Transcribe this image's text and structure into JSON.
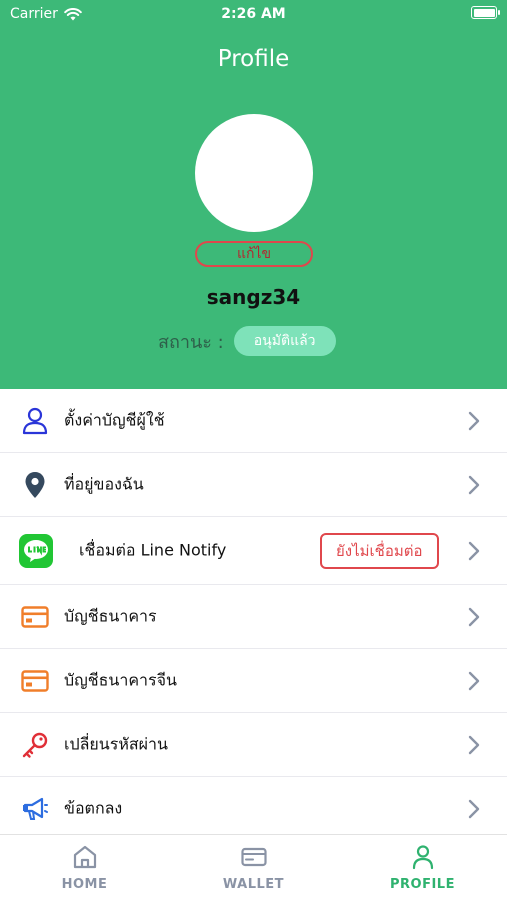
{
  "status_bar": {
    "carrier": "Carrier",
    "time": "2:26 AM"
  },
  "header": {
    "title": "Profile",
    "edit_label": "แก้ไข",
    "username": "sangz34",
    "status_label": "สถานะ :",
    "status_value": "อนุมัติแล้ว"
  },
  "menu": {
    "items": [
      {
        "label": "ตั้งค่าบัญชีผู้ใช้",
        "icon": "user-icon"
      },
      {
        "label": "ที่อยู่ของฉัน",
        "icon": "location-pin-icon"
      },
      {
        "label": "เชื่อมต่อ Line Notify",
        "icon": "line-app-icon",
        "badge": "ยังไม่เชื่อมต่อ"
      },
      {
        "label": "บัญชีธนาคาร",
        "icon": "credit-card-icon"
      },
      {
        "label": "บัญชีธนาคารจีน",
        "icon": "credit-card-icon"
      },
      {
        "label": "เปลี่ยนรหัสผ่าน",
        "icon": "key-icon"
      },
      {
        "label": "ข้อตกลง",
        "icon": "megaphone-icon"
      }
    ]
  },
  "tabbar": {
    "tabs": [
      {
        "label": "HOME",
        "icon": "home-icon"
      },
      {
        "label": "WALLET",
        "icon": "wallet-icon"
      },
      {
        "label": "PROFILE",
        "icon": "profile-icon",
        "active": true
      }
    ]
  },
  "colors": {
    "brand_green": "#3db978",
    "badge_red": "#e0474c",
    "active_tab": "#2fb26f"
  }
}
